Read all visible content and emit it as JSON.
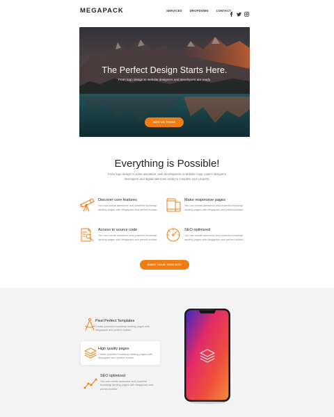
{
  "brand": {
    "name": "MEGAPACK",
    "accent": "#f07c12"
  },
  "nav": {
    "items": [
      "SERVICES",
      "DROPDOWN",
      "CONTACT"
    ]
  },
  "social": {
    "icons": [
      "facebook-icon",
      "twitter-icon",
      "instagram-icon"
    ]
  },
  "hero": {
    "title": "The Perfect Design Starts Here.",
    "subtitle": "From logo design to website designers and developers are ready.",
    "button": "JOIN US TODAY"
  },
  "possible": {
    "title": "Everything is Possible!",
    "description": "From logo design to video animation, web development to website copy, expert designers developers and digital talent are ready to complete your projects.",
    "features": [
      {
        "title": "Discover core features",
        "desc": "You can create awesome and powerful bootstrap landing pages with Megapack and perfect builder.",
        "icon": "telescope-icon"
      },
      {
        "title": "Make responsive pages",
        "desc": "You can create awesome and powerful bootstrap landing pages with Megapack and perfect builder.",
        "icon": "devices-icon"
      },
      {
        "title": "Access to source code",
        "desc": "You can create awesome and powerful bootstrap landing pages with Megapack and perfect builder.",
        "icon": "document-search-icon"
      },
      {
        "title": "SEO optimized",
        "desc": "You can create awesome and powerful bootstrap landing pages with Megapack and perfect builder.",
        "icon": "gauge-icon"
      }
    ],
    "button": "MAKE YOUR OWN SITE"
  },
  "showcase": {
    "items": [
      {
        "title": "Pixel Perfect Templates",
        "desc": "Create powerful bootstrap landing pages with Megapack and perfect builder.",
        "icon": "compass-icon"
      },
      {
        "title": "High quality pages",
        "desc": "Create powerful bootstrap landing pages with Megapack and perfect builder.",
        "icon": "layers-icon"
      },
      {
        "title": "SEO optimized",
        "desc": "You can create awesome and powerful bootstrap landing pages with Megapack and perfect builder.",
        "icon": "chart-line-icon"
      }
    ]
  }
}
